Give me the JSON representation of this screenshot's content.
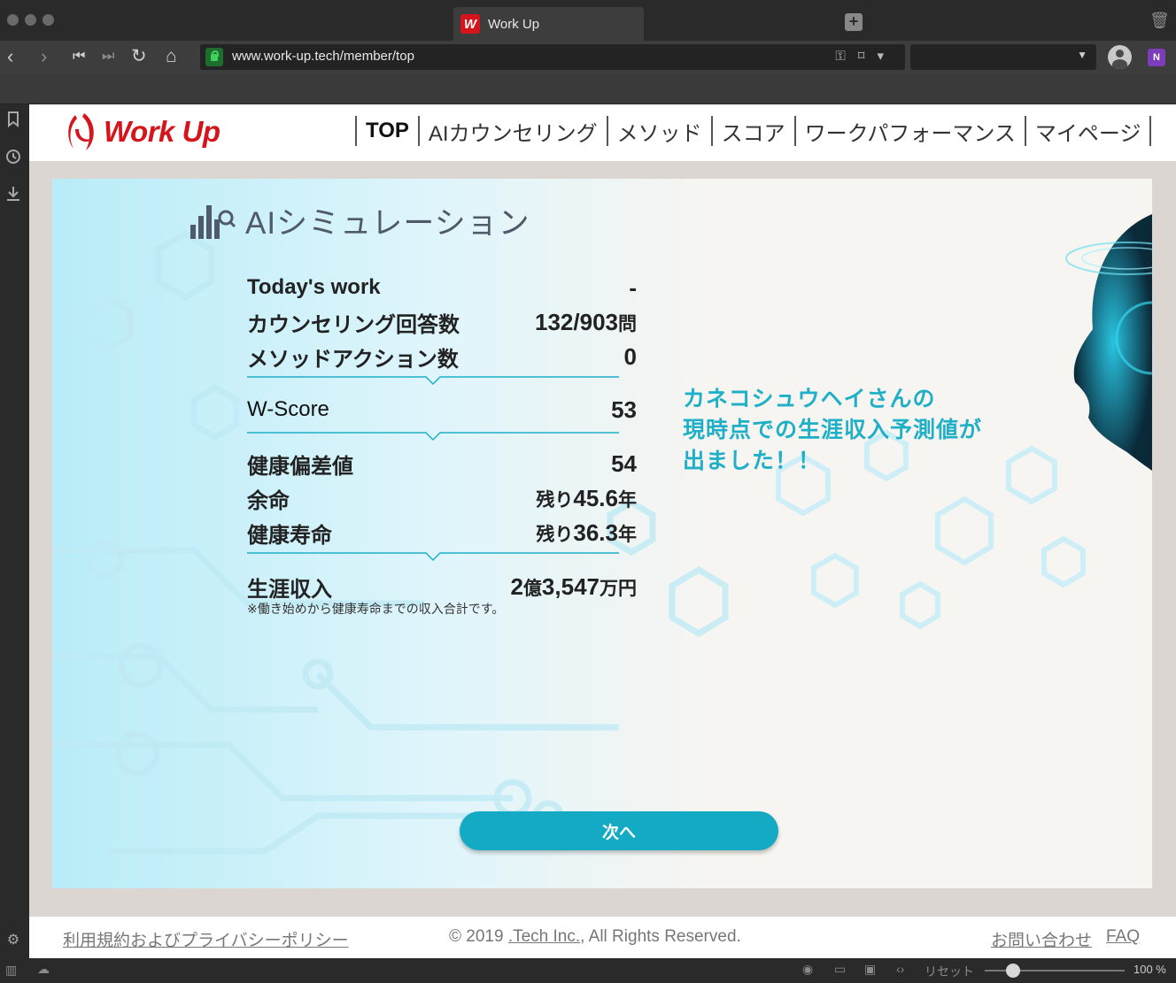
{
  "browser": {
    "tab_title": "Work Up",
    "tab_logo": "W",
    "url": "www.work-up.tech/member/top",
    "zoom_reset": "リセット",
    "zoom_level": "100 %"
  },
  "site": {
    "logo_text": "Work Up",
    "nav": [
      "TOP",
      "AIカウンセリング",
      "メソッド",
      "スコア",
      "ワークパフォーマンス",
      "マイページ"
    ],
    "active_nav": "TOP"
  },
  "simulation": {
    "title": "AIシミュレーション",
    "todays_work": {
      "label": "Today's work",
      "value": "-"
    },
    "counseling": {
      "label": "カウンセリング回答数",
      "value": "132/903",
      "unit": "問"
    },
    "method_actions": {
      "label": "メソッドアクション数",
      "value": "0"
    },
    "wscore": {
      "label": "W-Score",
      "value": "53"
    },
    "health_dev": {
      "label": "健康偏差値",
      "value": "54"
    },
    "life_left": {
      "label": "余命",
      "prefix": "残り",
      "value": "45.6",
      "unit": "年"
    },
    "healthy_life": {
      "label": "健康寿命",
      "prefix": "残り",
      "value": "36.3",
      "unit": "年"
    },
    "lifetime_income": {
      "label": "生涯収入",
      "value_a": "2",
      "unit_a": "億",
      "value_b": "3,547",
      "unit_b": "万円"
    },
    "note": "※働き始めから健康寿命までの収入合計です。",
    "message_lines": [
      "カネコシュウヘイさんの",
      "現時点での生涯収入予測値が",
      "出ました！！"
    ],
    "next_button": "次へ"
  },
  "footer": {
    "terms": "利用規約およびプライバシーポリシー",
    "copyright_pre": "© 2019 ",
    "company": ".Tech Inc.",
    "copyright_post": ", All Rights Reserved.",
    "contact": "お問い合わせ",
    "faq": "FAQ"
  },
  "colors": {
    "brand_red": "#d6141c",
    "accent_teal": "#14aac4"
  }
}
